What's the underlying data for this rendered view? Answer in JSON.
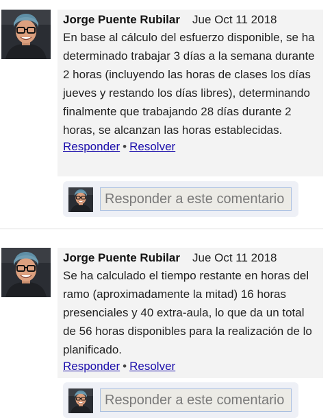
{
  "comments": [
    {
      "author": "Jorge Puente Rubilar",
      "date": "Jue Oct 11 2018",
      "text": "En base al cálculo del esfuerzo disponible, se ha determinado trabajar 3 días a la semana durante 2 horas (incluyendo las horas de clases los días jueves y restando los días libres), determinando finalmente que trabajando 28 días durante 2 horas, se alcanzan las horas establecidas.",
      "reply_label": "Responder",
      "separator": "•",
      "resolve_label": "Resolver",
      "reply_placeholder": "Responder a este comentario"
    },
    {
      "author": "Jorge Puente Rubilar",
      "date": "Jue Oct 11 2018",
      "text": "Se ha calculado el tiempo restante en horas del ramo (aproximadamente la mitad) 16 horas presenciales y 40 extra-aula, lo que da un total de 56 horas disponibles para la realización de lo planificado.",
      "reply_label": "Responder",
      "separator": "•",
      "resolve_label": "Resolver",
      "reply_placeholder": "Responder a este comentario"
    }
  ],
  "colors": {
    "link": "#1a0dab",
    "comment_bg": "#f3f3f3",
    "reply_bg": "#eef0f6",
    "input_border": "#a9bfe0"
  }
}
